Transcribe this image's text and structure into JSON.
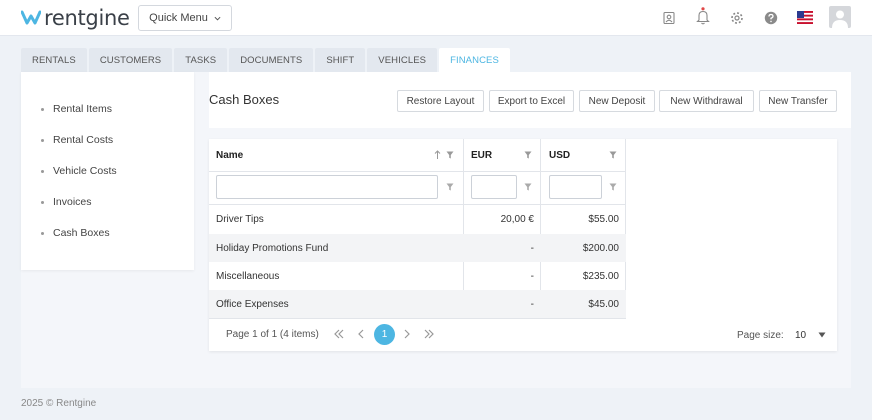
{
  "app": {
    "logo_text": "rentgine",
    "quick_menu_label": "Quick Menu",
    "brand_color": "#4db6e2"
  },
  "header_icons": [
    "id-card-icon",
    "bell-icon",
    "gear-icon",
    "help-icon",
    "us-flag-icon",
    "avatar-icon"
  ],
  "tabs": [
    {
      "label": "RENTALS"
    },
    {
      "label": "CUSTOMERS"
    },
    {
      "label": "TASKS"
    },
    {
      "label": "DOCUMENTS"
    },
    {
      "label": "SHIFT"
    },
    {
      "label": "VEHICLES"
    },
    {
      "label": "FINANCES",
      "active": true
    }
  ],
  "sidebar": {
    "items": [
      {
        "label": "Rental Items"
      },
      {
        "label": "Rental Costs"
      },
      {
        "label": "Vehicle Costs"
      },
      {
        "label": "Invoices"
      },
      {
        "label": "Cash Boxes"
      }
    ]
  },
  "content": {
    "title": "Cash Boxes",
    "toolbar": {
      "restore_layout": "Restore Layout",
      "export_excel": "Export to Excel",
      "new_deposit": "New Deposit",
      "new_withdrawal": "New Withdrawal",
      "new_transfer": "New Transfer"
    }
  },
  "grid": {
    "columns": [
      "Name",
      "EUR",
      "USD"
    ],
    "rows": [
      {
        "name": "Driver Tips",
        "eur": "20,00 €",
        "usd": "$55.00"
      },
      {
        "name": "Holiday Promotions Fund",
        "eur": "-",
        "usd": "$200.00"
      },
      {
        "name": "Miscellaneous",
        "eur": "-",
        "usd": "$235.00"
      },
      {
        "name": "Office Expenses",
        "eur": "-",
        "usd": "$45.00"
      }
    ],
    "pager": {
      "info": "Page 1 of 1 (4 items)",
      "current_page": "1",
      "page_size_label": "Page size:",
      "page_size_value": "10"
    }
  },
  "footer": {
    "text": "2025 © Rentgine"
  }
}
